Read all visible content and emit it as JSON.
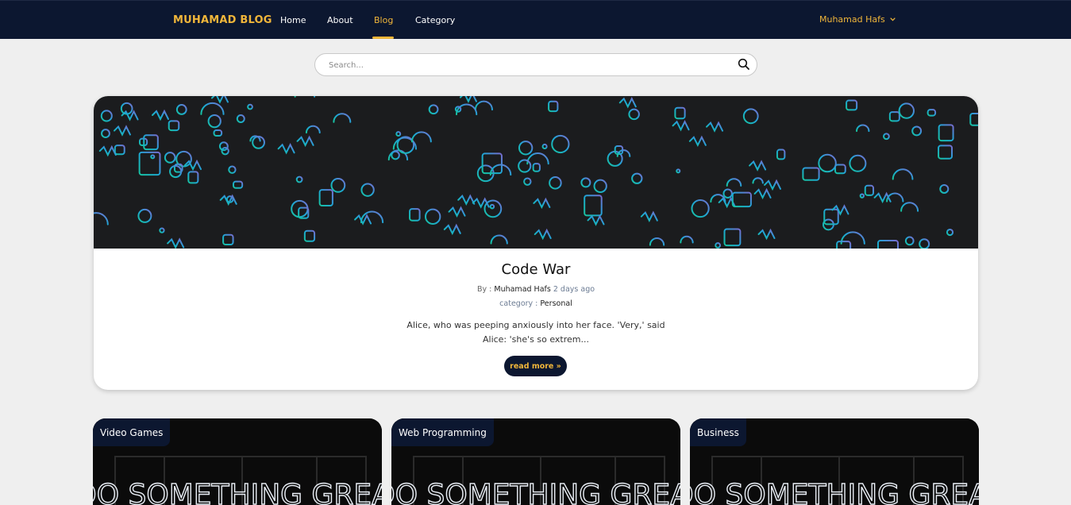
{
  "nav": {
    "brand": "MUHAMAD BLOG",
    "links": [
      "Home",
      "About",
      "Blog",
      "Category"
    ],
    "active": "Blog",
    "user": "Muhamad Hafs",
    "user_icon": "chevron-down-icon"
  },
  "search": {
    "placeholder": "Search...",
    "icon": "search-icon"
  },
  "featured": {
    "title": "Code War",
    "by_label": "By :",
    "author": "Muhamad Hafs",
    "time": "2 days ago",
    "category_label": "category :",
    "category": "Personal",
    "excerpt": "Alice, who was peeping anxiously into her face. 'Very,' said Alice: 'she's so extrem...",
    "read_more": "read more »"
  },
  "cards": [
    {
      "category": "Video Games",
      "image_text": "DO SOMETHING GREAT"
    },
    {
      "category": "Web Programming",
      "image_text": "DO SOMETHING GREAT"
    },
    {
      "category": "Business",
      "image_text": "DO SOMETHING GREAT"
    }
  ],
  "colors": {
    "navbar": "#0c1730",
    "accent": "#f0b63a",
    "page_bg": "#efefef"
  }
}
